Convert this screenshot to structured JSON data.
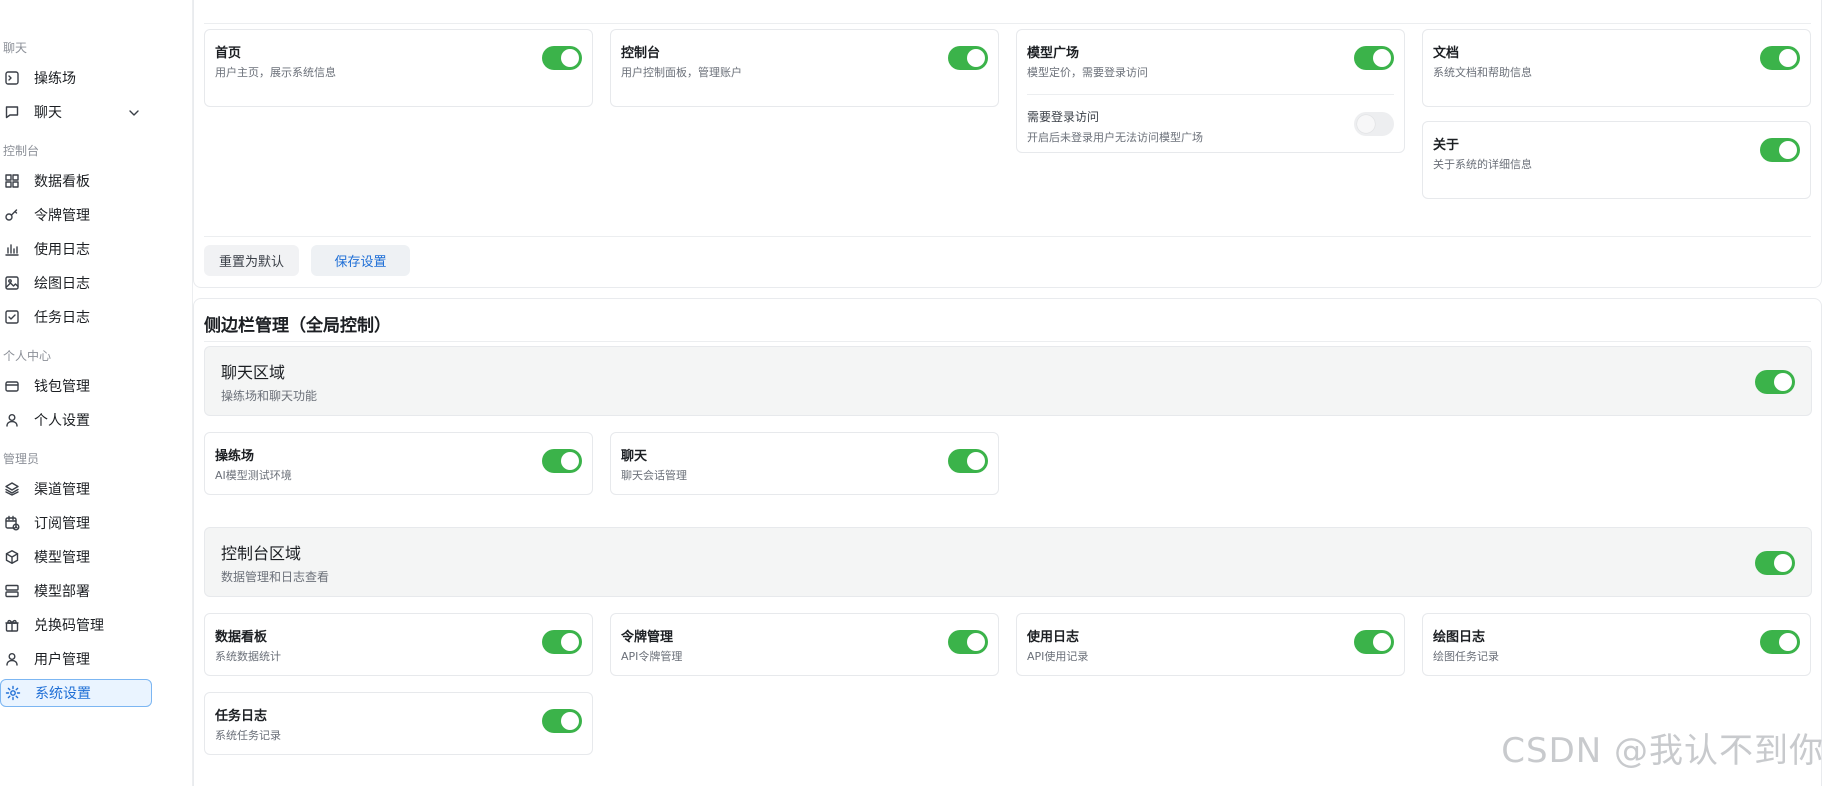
{
  "sidebar": {
    "sections": {
      "chat": "聊天",
      "console": "控制台",
      "personal": "个人中心",
      "admin": "管理员"
    },
    "items": {
      "playground": "操练场",
      "chat": "聊天",
      "dashboard": "数据看板",
      "tokens": "令牌管理",
      "usage_log": "使用日志",
      "drawing_log": "绘图日志",
      "task_log": "任务日志",
      "wallet": "钱包管理",
      "personal_settings": "个人设置",
      "channels": "渠道管理",
      "subscriptions": "订阅管理",
      "models": "模型管理",
      "model_deploy": "模型部署",
      "redeem_codes": "兑换码管理",
      "users": "用户管理",
      "system_settings": "系统设置"
    },
    "active": "system_settings"
  },
  "header_module": {
    "cards": {
      "home": {
        "title": "首页",
        "desc": "用户主页，展示系统信息",
        "enabled": true
      },
      "console": {
        "title": "控制台",
        "desc": "用户控制面板，管理账户",
        "enabled": true
      },
      "model_square": {
        "title": "模型广场",
        "desc": "模型定价，需要登录访问",
        "enabled": true,
        "sub_title": "需要登录访问",
        "sub_desc": "开启后未登录用户无法访问模型广场",
        "sub_enabled": false
      },
      "docs": {
        "title": "文档",
        "desc": "系统文档和帮助信息",
        "enabled": true
      },
      "about": {
        "title": "关于",
        "desc": "关于系统的详细信息",
        "enabled": true
      }
    },
    "reset_label": "重置为默认",
    "save_label": "保存设置"
  },
  "sidebar_management": {
    "title": "侧边栏管理（全局控制）",
    "chat_area": {
      "title": "聊天区域",
      "desc": "操练场和聊天功能",
      "enabled": true,
      "items": [
        {
          "title": "操练场",
          "desc": "AI模型测试环境",
          "enabled": true
        },
        {
          "title": "聊天",
          "desc": "聊天会话管理",
          "enabled": true
        }
      ]
    },
    "console_area": {
      "title": "控制台区域",
      "desc": "数据管理和日志查看",
      "enabled": true,
      "items": [
        {
          "title": "数据看板",
          "desc": "系统数据统计",
          "enabled": true
        },
        {
          "title": "令牌管理",
          "desc": "API令牌管理",
          "enabled": true
        },
        {
          "title": "使用日志",
          "desc": "API使用记录",
          "enabled": true
        },
        {
          "title": "绘图日志",
          "desc": "绘图任务记录",
          "enabled": true
        },
        {
          "title": "任务日志",
          "desc": "系统任务记录",
          "enabled": true
        }
      ]
    }
  },
  "watermark": "CSDN @我认不到你",
  "colors": {
    "toggle_on": "#3bb34a",
    "toggle_off": "#edeef0",
    "accent": "#1f6fd6"
  }
}
